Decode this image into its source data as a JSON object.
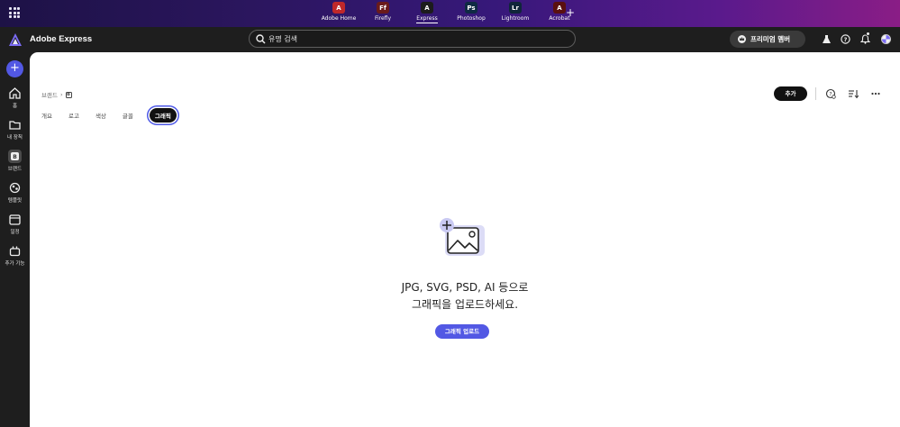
{
  "app_switcher": {
    "apps": [
      {
        "label": "Adobe Home",
        "glyph": "A",
        "color": "#c0282a"
      },
      {
        "label": "Firefly",
        "glyph": "Ff",
        "color": "#6a1b1b"
      },
      {
        "label": "Express",
        "glyph": "A",
        "color": "#1c1c1c",
        "active": true
      },
      {
        "label": "Photoshop",
        "glyph": "Ps",
        "color": "#0f2a44"
      },
      {
        "label": "Lightroom",
        "glyph": "Lr",
        "color": "#10263a"
      },
      {
        "label": "Acrobat",
        "glyph": "A",
        "color": "#5a1010"
      }
    ],
    "add_symbol": "+"
  },
  "header": {
    "title": "Adobe Express",
    "search_placeholder": "유명 검색",
    "premium_label": "프리미엄 멤버"
  },
  "leftnav": {
    "create_symbol": "+",
    "items": [
      {
        "label": "홈",
        "icon": "home-icon"
      },
      {
        "label": "내 장칙",
        "icon": "folder-icon"
      },
      {
        "label": "브랜드",
        "icon": "brand-icon",
        "active": true
      },
      {
        "label": "템플릿",
        "icon": "templates-icon"
      },
      {
        "label": "일정",
        "icon": "calendar-icon"
      },
      {
        "label": "추가 기능",
        "icon": "addons-icon"
      }
    ]
  },
  "main": {
    "breadcrumb": {
      "root": "브랜드",
      "separator": "›",
      "current_icon": "B"
    },
    "tabs": [
      "개요",
      "로고",
      "색상",
      "글꼴",
      "그래픽"
    ],
    "active_tab": 4,
    "add_label": "추가",
    "empty_state": {
      "line1": "JPG, SVG, PSD, AI 등으로",
      "line2": "그래픽을 업로드하세요.",
      "upload_label": "그래픽 업로드"
    }
  },
  "colors": {
    "accent": "#5258e4",
    "canvas": "#ffffff",
    "chrome": "#1e1e1e"
  }
}
